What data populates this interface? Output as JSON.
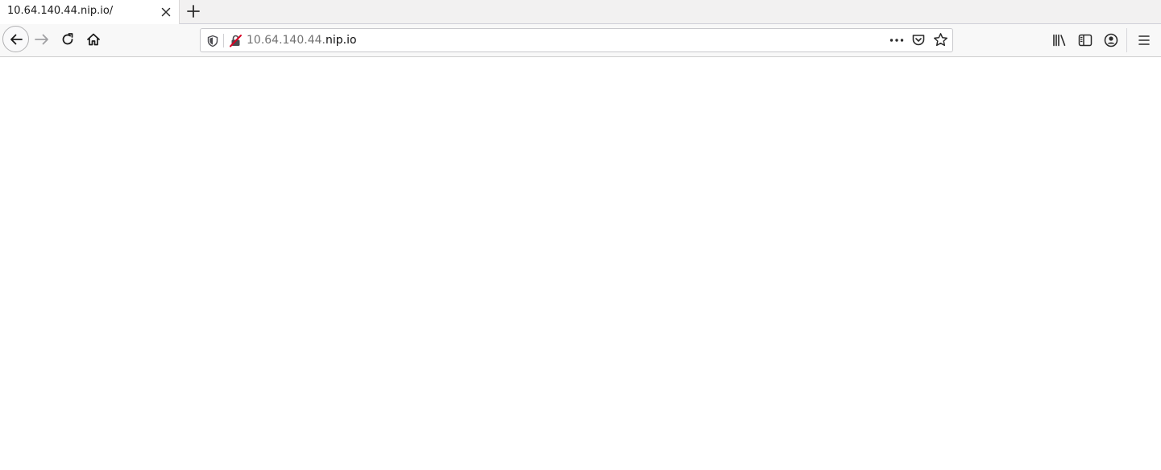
{
  "tab": {
    "title": "10.64.140.44.nip.io/",
    "close_icon": "close-icon",
    "new_tab_icon": "plus-icon"
  },
  "toolbar": {
    "back_icon": "arrow-left-icon",
    "forward_icon": "arrow-right-icon",
    "reload_icon": "reload-icon",
    "home_icon": "home-icon"
  },
  "urlbar": {
    "host_prefix": "10.64.140.44.",
    "host_domain": "nip.io",
    "tracking_icon": "shield-icon",
    "connection_icon": "insecure-lock-icon",
    "page_actions_icon": "more-horizontal-icon",
    "pocket_icon": "pocket-icon",
    "bookmark_icon": "star-icon"
  },
  "right_toolbar": {
    "library_icon": "library-icon",
    "sidebar_icon": "sidebar-icon",
    "account_icon": "account-icon",
    "menu_icon": "hamburger-menu-icon"
  },
  "colors": {
    "tabstrip_bg": "#f2f1f1",
    "navbar_bg": "#f8f8f8",
    "insecure_accent": "#d70022"
  }
}
